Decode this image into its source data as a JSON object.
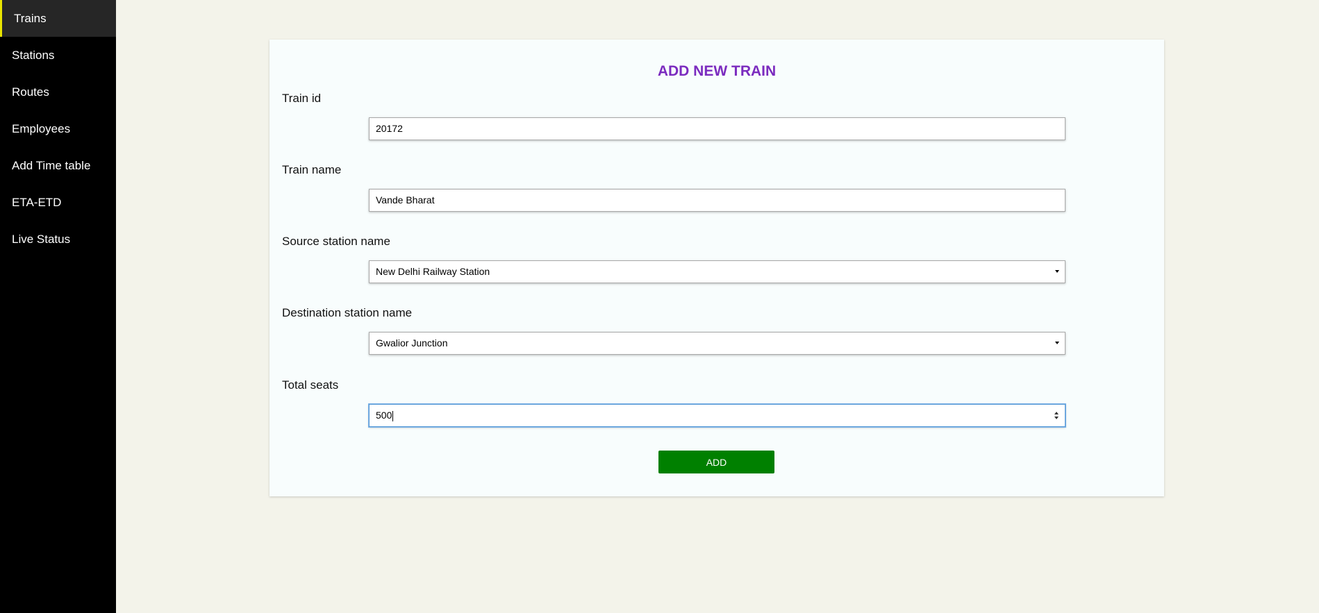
{
  "sidebar": {
    "items": [
      {
        "label": "Trains",
        "active": true
      },
      {
        "label": "Stations"
      },
      {
        "label": "Routes"
      },
      {
        "label": "Employees"
      },
      {
        "label": "Add Time table"
      },
      {
        "label": "ETA-ETD"
      },
      {
        "label": "Live Status"
      }
    ],
    "accent_color": "#e8e400"
  },
  "form": {
    "title": "ADD NEW TRAIN",
    "title_color": "#7b2bbf",
    "fields": {
      "train_id": {
        "label": "Train id",
        "value": "20172"
      },
      "train_name": {
        "label": "Train name",
        "value": "Vande Bharat"
      },
      "source_station": {
        "label": "Source station name",
        "value": "New Delhi Railway Station"
      },
      "destination_station": {
        "label": "Destination station name",
        "value": "Gwalior Junction"
      },
      "total_seats": {
        "label": "Total seats",
        "value": "500"
      }
    },
    "submit_label": "ADD",
    "submit_color": "#008000"
  }
}
